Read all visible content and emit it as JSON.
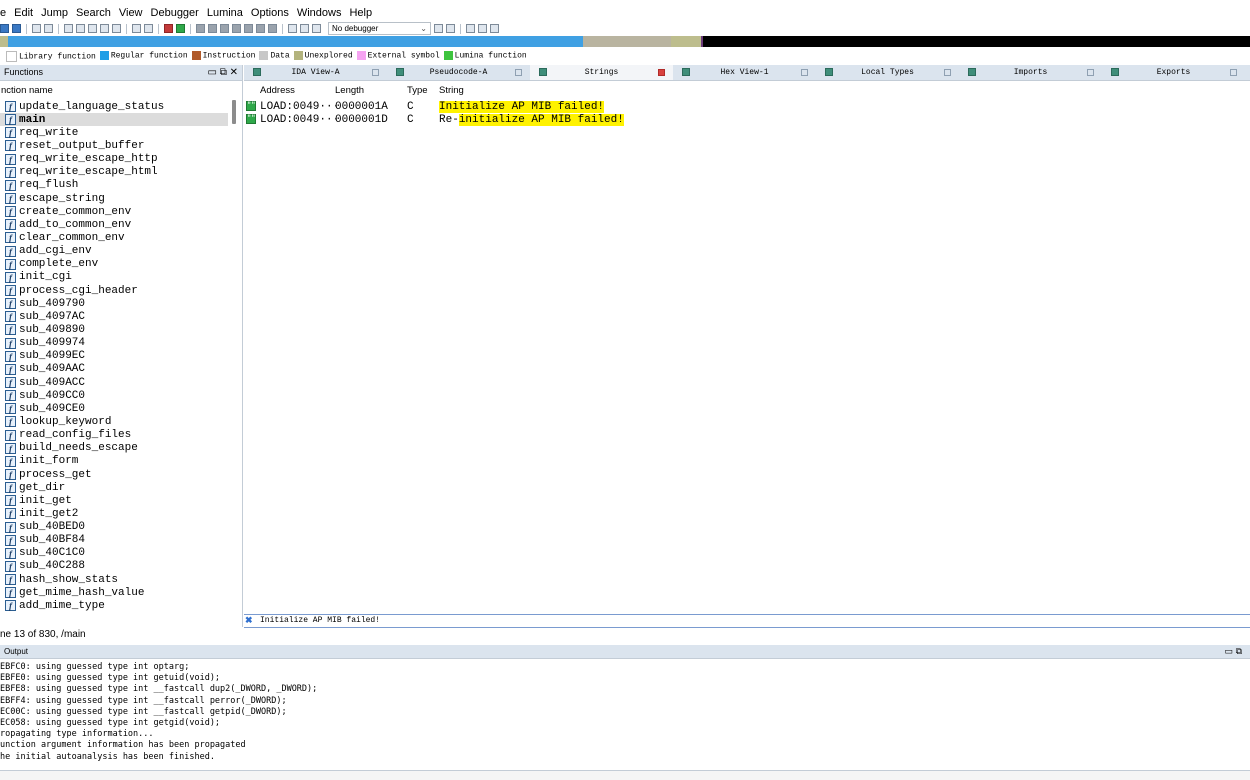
{
  "menu": [
    "e",
    "Edit",
    "Jump",
    "Search",
    "View",
    "Debugger",
    "Lumina",
    "Options",
    "Windows",
    "Help"
  ],
  "toolbar": {
    "debugger_value": "No debugger"
  },
  "navband_colors": {
    "library": "#3fa0e3",
    "unexplored": "#b9b4a0",
    "bg": "#000000",
    "data": "#bdbd8d"
  },
  "legend": [
    {
      "label": "Library function",
      "color": "#ffffff"
    },
    {
      "label": "Regular function",
      "color": "#1f9ee6"
    },
    {
      "label": "Instruction",
      "color": "#b05a2a"
    },
    {
      "label": "Data",
      "color": "#c8c8c8"
    },
    {
      "label": "Unexplored",
      "color": "#b3b37d"
    },
    {
      "label": "External symbol",
      "color": "#f6a3f2"
    },
    {
      "label": "Lumina function",
      "color": "#3ec43e"
    }
  ],
  "functions_panel": {
    "title": "Functions",
    "column": "nction name",
    "status": "ne 13 of 830, /main",
    "items": [
      "update_language_status",
      "main",
      "req_write",
      "reset_output_buffer",
      "req_write_escape_http",
      "req_write_escape_html",
      "req_flush",
      "escape_string",
      "create_common_env",
      "add_to_common_env",
      "clear_common_env",
      "add_cgi_env",
      "complete_env",
      "init_cgi",
      "process_cgi_header",
      "sub_409790",
      "sub_4097AC",
      "sub_409890",
      "sub_409974",
      "sub_4099EC",
      "sub_409AAC",
      "sub_409ACC",
      "sub_409CC0",
      "sub_409CE0",
      "lookup_keyword",
      "read_config_files",
      "build_needs_escape",
      "init_form",
      "process_get",
      "get_dir",
      "init_get",
      "init_get2",
      "sub_40BED0",
      "sub_40BF84",
      "sub_40C1C0",
      "sub_40C288",
      "hash_show_stats",
      "get_mime_hash_value",
      "add_mime_type"
    ]
  },
  "tabs": [
    {
      "label": "IDA View-A"
    },
    {
      "label": "Pseudocode-A"
    },
    {
      "label": "Strings"
    },
    {
      "label": "Hex View-1"
    },
    {
      "label": "Local Types"
    },
    {
      "label": "Imports"
    },
    {
      "label": "Exports"
    }
  ],
  "strings_panel": {
    "headers": {
      "address": "Address",
      "length": "Length",
      "type": "Type",
      "string": "String"
    },
    "rows": [
      {
        "address": "LOAD:0049···",
        "length": "0000001A",
        "type": "C",
        "prefix": "",
        "highlight": "Initialize AP MIB failed!"
      },
      {
        "address": "LOAD:0049···",
        "length": "0000001D",
        "type": "C",
        "prefix": "Re-",
        "highlight": "initialize AP MIB failed!"
      }
    ],
    "search_value": "Initialize AP MIB failed!"
  },
  "output_panel": {
    "title": "Output",
    "lines": [
      "EBFC0: using guessed type int optarg;",
      "EBFE0: using guessed type int getuid(void);",
      "EBFE8: using guessed type int __fastcall dup2(_DWORD, _DWORD);",
      "EBFF4: using guessed type int __fastcall perror(_DWORD);",
      "EC00C: using guessed type int __fastcall getpid(_DWORD);",
      "EC058: using guessed type int getgid(void);",
      "ropagating type information...",
      "unction argument information has been propagated",
      "he initial autoanalysis has been finished."
    ]
  }
}
